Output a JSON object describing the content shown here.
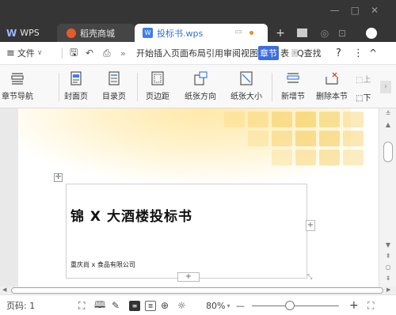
{
  "titlebar": {
    "tabs": [
      {
        "label": "WPS",
        "icon": "wps-logo-icon"
      },
      {
        "label": "稻壳商城",
        "icon": "docer-icon"
      },
      {
        "label": "投标书.wps",
        "icon": "wps-doc-icon"
      }
    ],
    "new_tab": "+",
    "window_controls": [
      "—",
      "□",
      "✕"
    ]
  },
  "menubar": {
    "menu_icon": "≡",
    "file_label": "文件",
    "more": "»",
    "menus": "开始插入页面布局引用审阅视图",
    "active_tab": "章节",
    "next_tab": "表",
    "search_label": "Q查找",
    "help": "?",
    "more_options": "⋮",
    "collapse": "^"
  },
  "ribbon": {
    "items": [
      {
        "label": "章节导航"
      },
      {
        "label": "封面页"
      },
      {
        "label": "目录页"
      },
      {
        "label": "页边距"
      },
      {
        "label": "纸张方向"
      },
      {
        "label": "纸张大小"
      },
      {
        "label": "新增节"
      },
      {
        "label": "删除本节"
      }
    ],
    "prev_label": "上",
    "next_label": "下"
  },
  "document": {
    "title": "锦 X 大酒楼投标书",
    "company": "重庆尚 x 食品有限公司",
    "add_symbol": "+"
  },
  "statusbar": {
    "page_label": "页码: 1",
    "zoom": "80%",
    "zoom_percent": 80,
    "zoom_minus": "—",
    "zoom_plus": "+"
  },
  "colors": {
    "titlebar_bg": "#353535",
    "accent": "#3c6de0",
    "cover_glow": "#f7d678"
  }
}
